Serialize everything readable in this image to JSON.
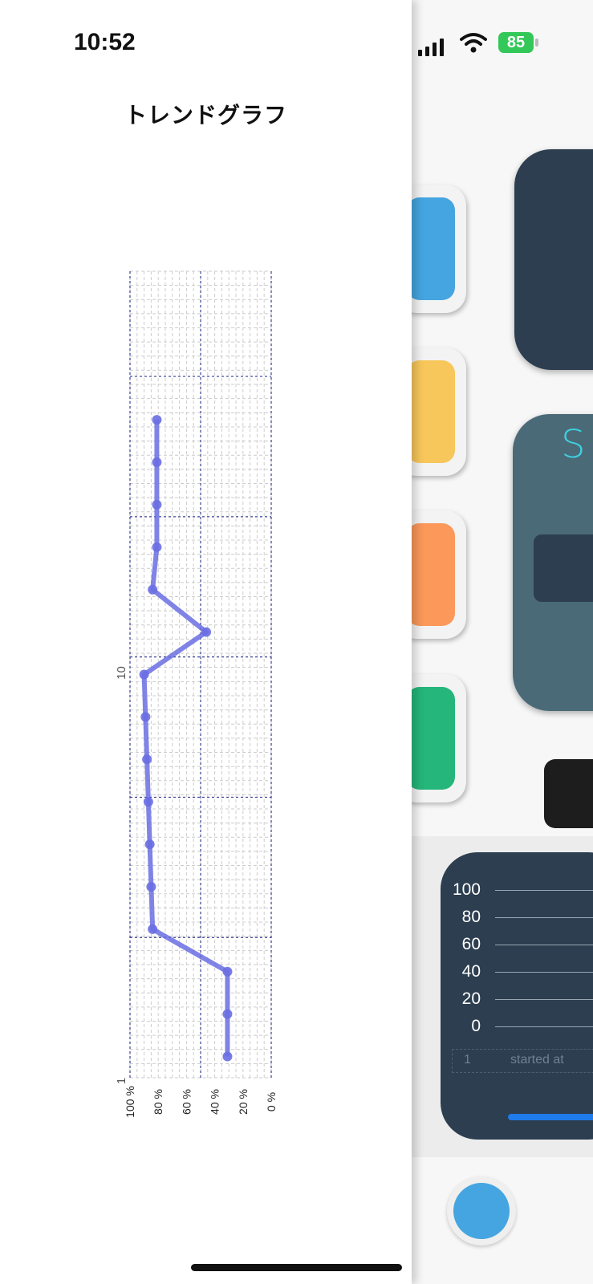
{
  "status_bar": {
    "time": "10:52",
    "battery": "85"
  },
  "header": {
    "title": "トレンドグラフ"
  },
  "chart_data": {
    "type": "line",
    "orientation": "rotated-90",
    "title": "トレンドグラフ",
    "x_axis": {
      "ticks": [
        "1",
        "10"
      ],
      "range": [
        1,
        15
      ]
    },
    "y_axis": {
      "ticks": [
        "100 %",
        "80 %",
        "60 %",
        "40 %",
        "20 %",
        "0 %"
      ],
      "range": [
        0,
        100
      ]
    },
    "grid": true,
    "series": [
      {
        "values": [
          31,
          31,
          31,
          84,
          85,
          86,
          87,
          88,
          89,
          90,
          46,
          84,
          81,
          81,
          81,
          81
        ],
        "x": [
          1,
          2,
          3,
          4,
          5,
          6,
          7,
          8,
          9,
          10,
          11,
          12,
          13,
          14,
          15,
          16
        ]
      }
    ],
    "colors": {
      "line": "#6a6ee2",
      "grid_major": "#3a3f8f",
      "grid_minor": "#cccccc"
    }
  },
  "background_app": {
    "tile_colors": [
      "#45a5e0",
      "#f8c75b",
      "#fb985a",
      "#24b67a"
    ],
    "mini_chart": {
      "ticks": [
        "100",
        "80",
        "60",
        "40",
        "20",
        "0"
      ],
      "cell_text": [
        "1",
        "started at"
      ]
    }
  }
}
